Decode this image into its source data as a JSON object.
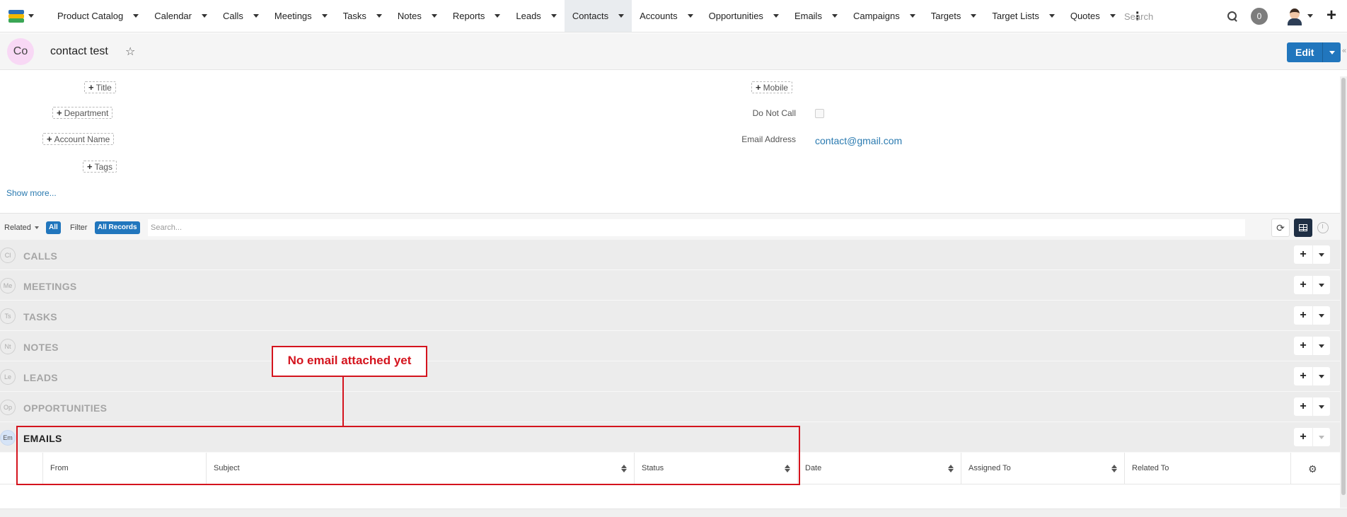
{
  "topnav": {
    "items": [
      {
        "label": "Product Catalog",
        "active": false
      },
      {
        "label": "Calendar",
        "active": false
      },
      {
        "label": "Calls",
        "active": false
      },
      {
        "label": "Meetings",
        "active": false
      },
      {
        "label": "Tasks",
        "active": false
      },
      {
        "label": "Notes",
        "active": false
      },
      {
        "label": "Reports",
        "active": false
      },
      {
        "label": "Leads",
        "active": false
      },
      {
        "label": "Contacts",
        "active": true
      },
      {
        "label": "Accounts",
        "active": false
      },
      {
        "label": "Opportunities",
        "active": false
      },
      {
        "label": "Emails",
        "active": false
      },
      {
        "label": "Campaigns",
        "active": false
      },
      {
        "label": "Targets",
        "active": false
      },
      {
        "label": "Target Lists",
        "active": false
      },
      {
        "label": "Quotes",
        "active": false
      }
    ],
    "search_placeholder": "Search",
    "notification_count": "0"
  },
  "record": {
    "avatar_initials": "Co",
    "name": "contact test",
    "edit_label": "Edit"
  },
  "fields": {
    "title_label": "Title",
    "department_label": "Department",
    "account_name_label": "Account Name",
    "tags_label": "Tags",
    "mobile_label": "Mobile",
    "do_not_call_label": "Do Not Call",
    "email_address_label": "Email Address",
    "email_address_value": "contact@gmail.com",
    "show_more": "Show more..."
  },
  "related_bar": {
    "related_label": "Related",
    "related_value": "All",
    "filter_label": "Filter",
    "filter_value": "All Records",
    "search_placeholder": "Search..."
  },
  "panels": [
    {
      "icon": "Cl",
      "title": "CALLS"
    },
    {
      "icon": "Me",
      "title": "MEETINGS"
    },
    {
      "icon": "Ts",
      "title": "TASKS"
    },
    {
      "icon": "Nt",
      "title": "NOTES"
    },
    {
      "icon": "Le",
      "title": "LEADS"
    },
    {
      "icon": "Op",
      "title": "OPPORTUNITIES"
    },
    {
      "icon": "Em",
      "title": "EMAILS"
    }
  ],
  "email_table": {
    "columns": [
      "From",
      "Subject",
      "Status",
      "Date",
      "Assigned To",
      "Related To"
    ]
  },
  "annotation": {
    "text": "No email attached yet",
    "color": "#d4141e"
  },
  "colors": {
    "accent": "#2176bd",
    "link": "#2a7ab0",
    "active_tab_bg": "#e9ecef"
  }
}
